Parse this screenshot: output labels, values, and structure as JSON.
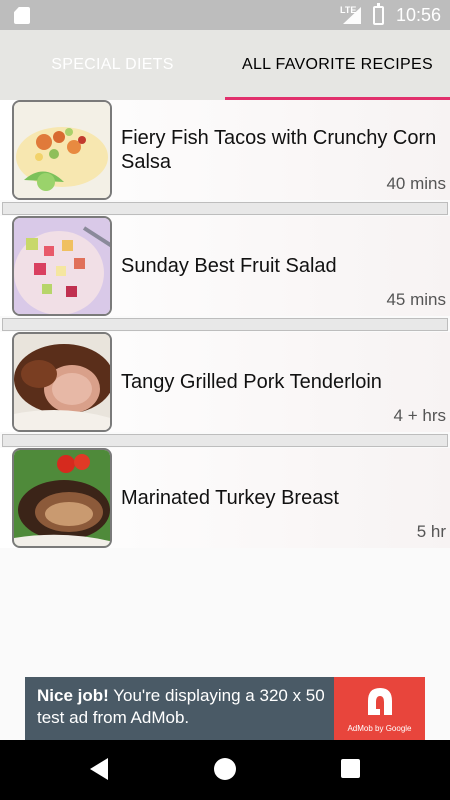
{
  "status_bar": {
    "time": "10:56",
    "network": "LTE",
    "icons": [
      "sim-card-icon",
      "signal-icon",
      "battery-charging-icon"
    ]
  },
  "tabs": [
    {
      "label": "SPECIAL DIETS",
      "selected": false
    },
    {
      "label": "ALL FAVORITE RECIPES",
      "selected": true
    }
  ],
  "accent_color": "#e1306c",
  "recipes": [
    {
      "title": "Fiery Fish Tacos with Crunchy Corn Salsa",
      "time": "40 mins",
      "image": "fish-tacos-photo"
    },
    {
      "title": "Sunday Best Fruit Salad",
      "time": "45 mins",
      "image": "fruit-salad-photo"
    },
    {
      "title": "Tangy Grilled Pork Tenderloin",
      "time": "4 + hrs",
      "image": "pork-tenderloin-photo"
    },
    {
      "title": "Marinated Turkey Breast",
      "time": "5 hr",
      "image": "turkey-breast-photo"
    }
  ],
  "ad": {
    "headline": "Nice job!",
    "body": " You're displaying a 320 x 50 test ad from AdMob.",
    "brand": "AdMob by Google"
  },
  "nav_bar": {
    "icons": [
      "back-icon",
      "home-icon",
      "recents-icon"
    ]
  }
}
